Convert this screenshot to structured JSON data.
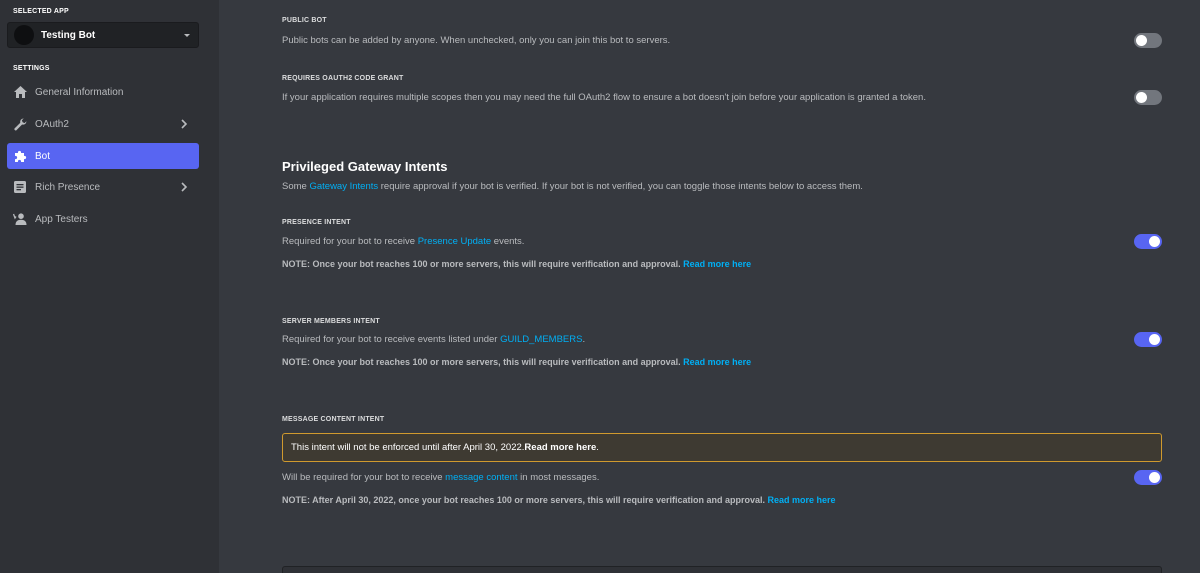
{
  "sidebar": {
    "selected_app_heading": "SELECTED APP",
    "app_name": "Testing Bot",
    "settings_heading": "SETTINGS",
    "items": [
      {
        "label": "General Information",
        "icon": "home-icon"
      },
      {
        "label": "OAuth2",
        "icon": "wrench-icon"
      },
      {
        "label": "Bot",
        "icon": "puzzle-icon",
        "active": true
      },
      {
        "label": "Rich Presence",
        "icon": "document-icon"
      },
      {
        "label": "App Testers",
        "icon": "person-add-icon"
      }
    ]
  },
  "public_bot": {
    "label": "PUBLIC BOT",
    "description": "Public bots can be added by anyone. When unchecked, only you can join this bot to servers.",
    "enabled": false
  },
  "oauth2_grant": {
    "label": "REQUIRES OAUTH2 CODE GRANT",
    "description": "If your application requires multiple scopes then you may need the full OAuth2 flow to ensure a bot doesn't join before your application is granted a token.",
    "enabled": false
  },
  "privileged": {
    "title": "Privileged Gateway Intents",
    "desc_pre": "Some ",
    "desc_link": "Gateway Intents",
    "desc_post": " require approval if your bot is verified. If your bot is not verified, you can toggle those intents below to access them."
  },
  "presence_intent": {
    "label": "PRESENCE INTENT",
    "desc_pre": "Required for your bot to receive ",
    "desc_link": "Presence Update",
    "desc_post": " events.",
    "note": "NOTE: Once your bot reaches 100 or more servers, this will require verification and approval.",
    "note_link": "Read more here",
    "enabled": true
  },
  "members_intent": {
    "label": "SERVER MEMBERS INTENT",
    "desc_pre": "Required for your bot to receive events listed under ",
    "desc_link": "GUILD_MEMBERS",
    "desc_post": ".",
    "note": "NOTE: Once your bot reaches 100 or more servers, this will require verification and approval.",
    "note_link": "Read more here",
    "enabled": true
  },
  "message_intent": {
    "label": "MESSAGE CONTENT INTENT",
    "warning_text": "This intent will not be enforced until after April 30, 2022. ",
    "warning_link": "Read more here",
    "warning_end": ".",
    "desc_pre": "Will be required for your bot to receive ",
    "desc_link": "message content",
    "desc_post": " in most messages.",
    "note": "NOTE: After April 30, 2022, once your bot reaches 100 or more servers, this will require verification and approval.",
    "note_link": "Read more here",
    "enabled": true
  },
  "colors": {
    "accent": "#5865f2",
    "link": "#00aff4",
    "warning_border": "#d09a2e"
  }
}
